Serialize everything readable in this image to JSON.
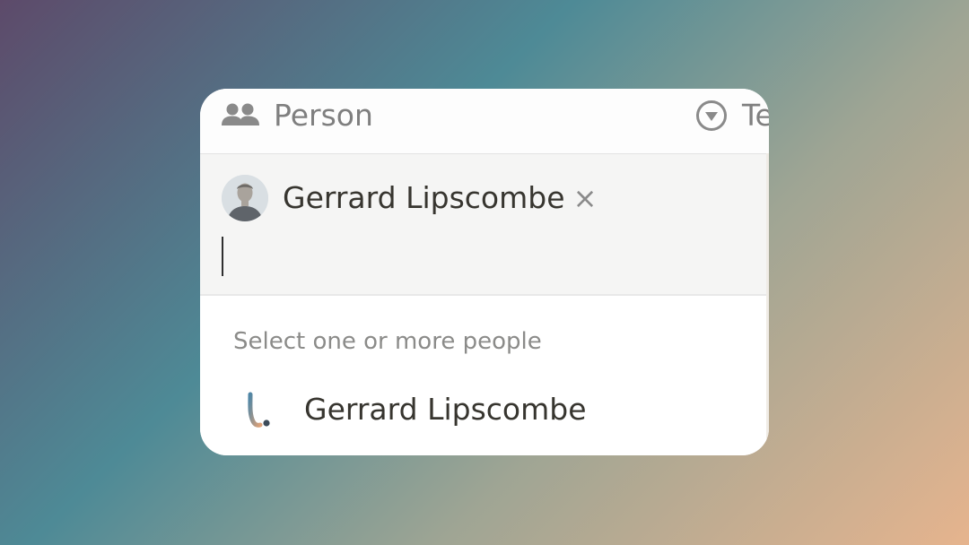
{
  "header": {
    "person_column": {
      "label": "Person",
      "icon": "people-icon"
    },
    "next_column": {
      "label": "Te",
      "icon": "status-circle-icon"
    }
  },
  "picker": {
    "selected": {
      "name": "Gerrard Lipscombe",
      "remove_symbol": "×",
      "avatar": "avatar-photo"
    },
    "section_label": "Select one or more people",
    "options": [
      {
        "name": "Gerrard Lipscombe",
        "icon": "l-logo-icon"
      }
    ]
  },
  "colors": {
    "text_primary": "#37352f",
    "text_muted": "#7f7f7f",
    "input_bg": "#f5f5f4"
  }
}
